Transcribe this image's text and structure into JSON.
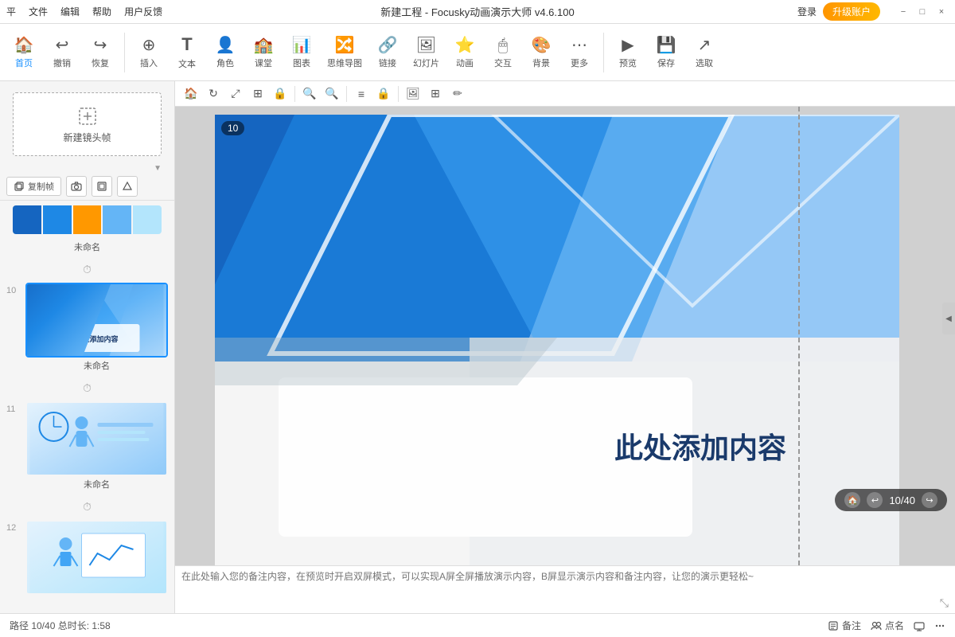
{
  "titlebar": {
    "menu": [
      "平",
      "文件",
      "编辑",
      "帮助",
      "用户反馈"
    ],
    "title": "新建工程 - Focusky动画演示大师 v4.6.100",
    "login": "登录",
    "upgrade": "升级账户",
    "win_min": "−",
    "win_max": "□",
    "win_close": "×"
  },
  "toolbar": {
    "home": "首页",
    "undo": "撤销",
    "redo": "恢复",
    "insert": "插入",
    "text": "文本",
    "role": "角色",
    "class": "课堂",
    "chart": "图表",
    "mindmap": "思维导图",
    "link": "链接",
    "slideshow": "幻灯片",
    "animation": "动画",
    "interact": "交互",
    "background": "背景",
    "more": "更多",
    "preview": "预览",
    "save": "保存",
    "select": "选取"
  },
  "sidebar": {
    "new_frame_label": "新建镜头帧",
    "copy_frame": "复制帧",
    "unnamed": "未命名",
    "slide10_num": "10",
    "slide11_num": "11",
    "slide12_num": "12",
    "theme_colors": [
      "#2196f3",
      "#1565c0",
      "#ff9800",
      "#90caf9",
      "#b3e5fc"
    ]
  },
  "canvas": {
    "badge": "10",
    "main_text": "此处添加内容",
    "slide_counter": "10/40",
    "notes_placeholder": "在此处输入您的备注内容，在预览时开启双屏模式，可以实现A屏全屏播放演示内容，B屏显示演示内容和备注内容，让您的演示更轻松~"
  },
  "statusbar": {
    "path": "路径 10/40  总时长: 1:58",
    "notes": "备注",
    "checkin": "点名",
    "screen_btn": "⬛",
    "more": "⋯"
  },
  "icons": {
    "home": "🏠",
    "undo": "↩",
    "redo": "↪",
    "insert": "⊕",
    "text": "T",
    "role": "👤",
    "class": "🏫",
    "chart": "📊",
    "mindmap": "🔀",
    "link": "🔗",
    "slideshow": "🖼",
    "animation": "⭐",
    "interact": "🖱",
    "background": "🎨",
    "more": "⋯",
    "preview": "▶",
    "save": "💾",
    "select": "↗",
    "new_frame": "+",
    "copy": "⧉",
    "camera": "📷",
    "crop": "⊡",
    "shape": "△",
    "house": "🏠",
    "rotate": "↻",
    "flip": "⤢",
    "layer": "⊞",
    "zoom_in": "🔍+",
    "zoom_out": "🔍−",
    "align": "≡",
    "lock": "🔒",
    "photo": "🖼",
    "grid": "⊞",
    "draw": "✏",
    "notes_icon": "📝",
    "checkin_icon": "👥",
    "expand": "⤡"
  }
}
